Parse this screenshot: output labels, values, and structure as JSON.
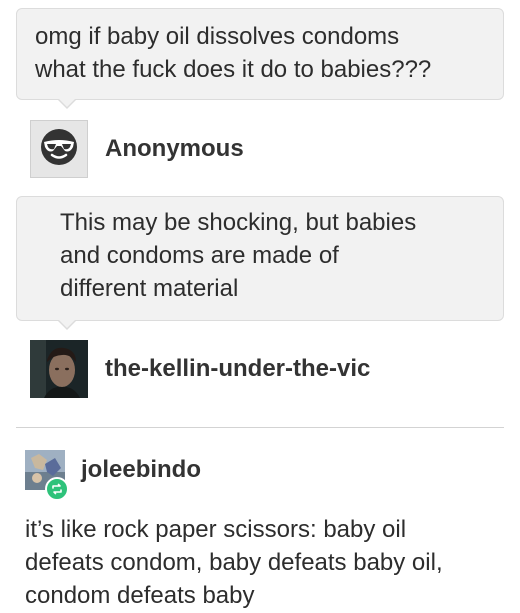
{
  "thread": {
    "question": {
      "lines": [
        "omg if baby oil dissolves condoms",
        "what the fuck does it do to babies???"
      ],
      "author": "Anonymous",
      "author_icon": "sunglasses-face-icon"
    },
    "answer": {
      "lines": [
        "This may be shocking, but babies",
        "and condoms are made of",
        "different material"
      ],
      "author": "the-kellin-under-the-vic"
    },
    "reblog": {
      "author": "joleebindo",
      "badge_icon": "reblog-icon",
      "badge_color": "#2ec27a",
      "lines": [
        "it’s like rock paper scissors: baby oil",
        "defeats condom, baby defeats baby oil,",
        "condom defeats baby"
      ]
    }
  }
}
